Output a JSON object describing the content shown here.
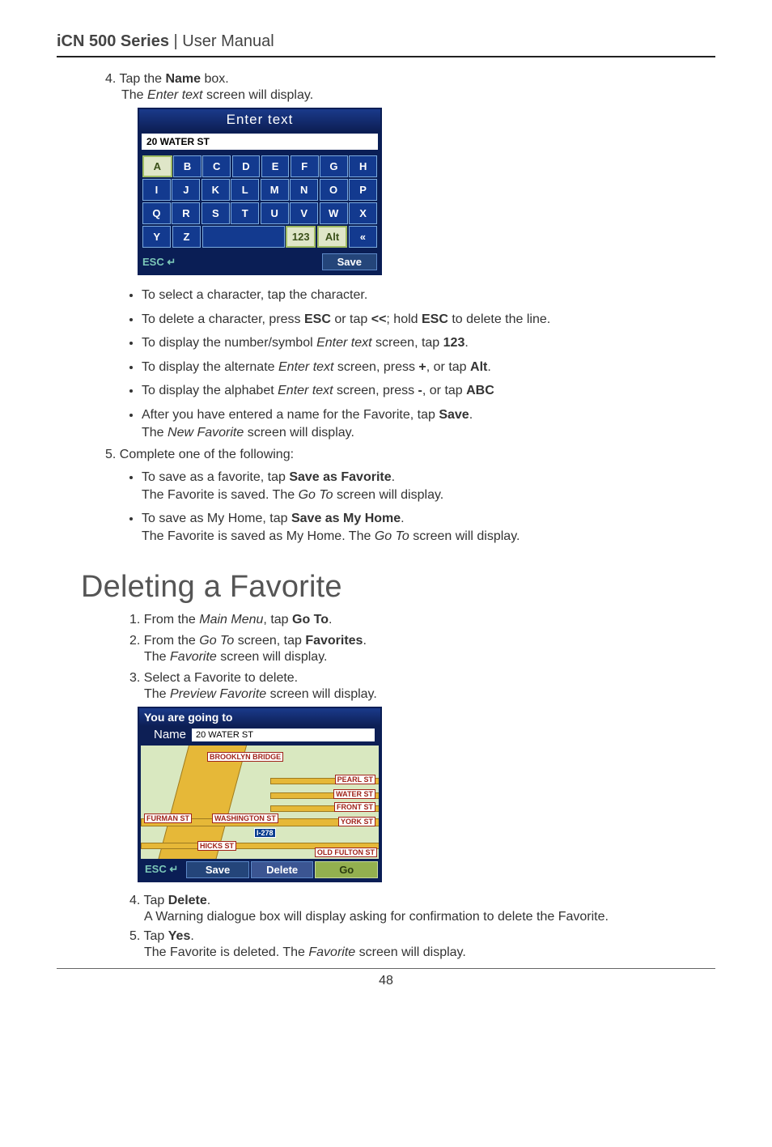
{
  "header": {
    "product": "iCN 500 Series",
    "separator": " | ",
    "title": "User Manual"
  },
  "step4": {
    "num": "4.",
    "text1": "Tap the ",
    "bold": "Name",
    "text2": " box.",
    "sub1a": "The ",
    "sub1i": "Enter text",
    "sub1b": " screen will display."
  },
  "kbd": {
    "title": "Enter text",
    "entry": "20 WATER ST",
    "rows": [
      [
        "A",
        "B",
        "C",
        "D",
        "E",
        "F",
        "G",
        "H"
      ],
      [
        "I",
        "J",
        "K",
        "L",
        "M",
        "N",
        "O",
        "P"
      ],
      [
        "Q",
        "R",
        "S",
        "T",
        "U",
        "V",
        "W",
        "X"
      ]
    ],
    "row4": {
      "y": "Y",
      "z": "Z",
      "num": "123",
      "alt": "Alt",
      "back": "«"
    },
    "esc": "ESC ↵",
    "save": "Save"
  },
  "bullets1": [
    {
      "pre": "To select a character, tap the character."
    },
    {
      "pre": "To delete a character, press ",
      "b1": "ESC",
      "mid1": " or tap ",
      "b2": "<<",
      "mid2": "; hold ",
      "b3": "ESC",
      "post": " to delete the line."
    },
    {
      "pre": "To display the number/symbol ",
      "i1": "Enter text",
      "mid1": " screen, tap ",
      "b1": "123",
      "post": "."
    },
    {
      "pre": "To display the alternate ",
      "i1": "Enter text",
      "mid1": " screen, press ",
      "b1": "+",
      "mid2": ", or tap ",
      "b2": "Alt",
      "post": "."
    },
    {
      "pre": "To display the alphabet ",
      "i1": "Enter text",
      "mid1": " screen, press ",
      "b1": "-",
      "mid2": ", or tap ",
      "b2": "ABC"
    },
    {
      "pre": "After you have entered a name for the Favorite, tap ",
      "b1": "Save",
      "post": ".",
      "sub_pre": "The ",
      "sub_i": "New Favorite",
      "sub_post": " screen will display."
    }
  ],
  "step5": {
    "num": "5.",
    "text": "Complete one of the following:"
  },
  "bullets2": [
    {
      "pre": "To save as a favorite, tap ",
      "b1": "Save as Favorite",
      "post": ".",
      "sub_pre": "The Favorite is saved. The ",
      "sub_i": "Go To",
      "sub_post": " screen will display."
    },
    {
      "pre": "To save as My Home, tap ",
      "b1": "Save as My Home",
      "post": ".",
      "sub_pre": "The Favorite is saved as My Home. The ",
      "sub_i": "Go To",
      "sub_post": " screen will display."
    }
  ],
  "section2": "Deleting a Favorite",
  "del_steps": {
    "s1": {
      "num": "1.",
      "pre": "From the ",
      "i": "Main Menu",
      "mid": ", tap ",
      "b": "Go To",
      "post": "."
    },
    "s2": {
      "num": "2.",
      "pre": "From the ",
      "i": "Go To",
      "mid": " screen, tap ",
      "b": "Favorites",
      "post": ".",
      "sub_pre": "The ",
      "sub_i": "Favorite",
      "sub_post": " screen will display."
    },
    "s3": {
      "num": "3.",
      "pre": "Select a Favorite to delete.",
      "sub_pre": "The ",
      "sub_i": "Preview Favorite",
      "sub_post": " screen will display."
    }
  },
  "preview": {
    "title": "You are going to",
    "name_label": "Name",
    "name_value": "20 WATER ST",
    "labels": {
      "brooklyn": "BROOKLYN BRIDGE",
      "pearl": "PEARL ST",
      "water": "WATER ST",
      "front": "FRONT ST",
      "york": "YORK ST",
      "furman": "FURMAN ST",
      "washington": "WASHINGTON ST",
      "i278": "I-278",
      "hicks": "HICKS ST",
      "oldfulton": "OLD FULTON ST"
    },
    "esc": "ESC ↵",
    "save": "Save",
    "delete": "Delete",
    "go": "Go"
  },
  "del_steps2": {
    "s4": {
      "num": "4.",
      "pre": "Tap ",
      "b": "Delete",
      "post": ".",
      "sub": "A Warning dialogue box will display asking for confirmation to delete the Favorite."
    },
    "s5": {
      "num": "5.",
      "pre": "Tap ",
      "b": "Yes",
      "post": ".",
      "sub_pre": "The Favorite is deleted. The ",
      "sub_i": "Favorite",
      "sub_post": " screen will display."
    }
  },
  "page_number": "48"
}
